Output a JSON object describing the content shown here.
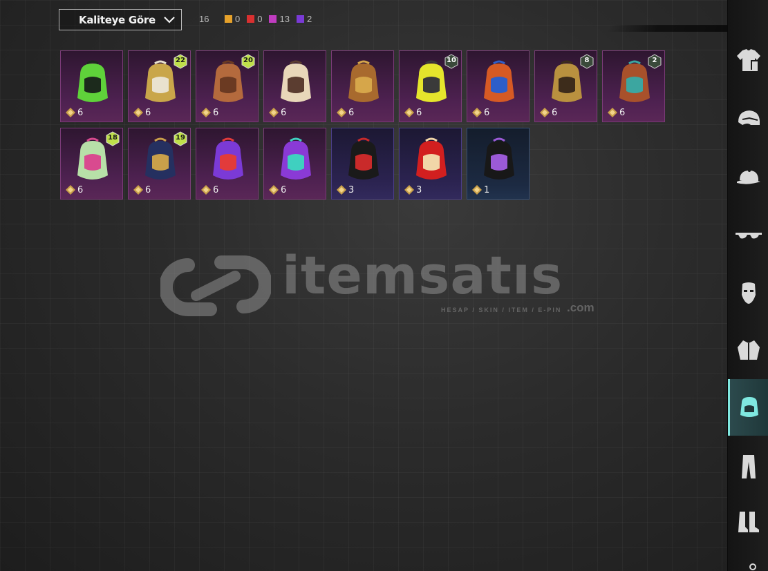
{
  "sort": {
    "label": "Kaliteye Göre"
  },
  "counts": {
    "total": "16",
    "legend": [
      {
        "color": "#e6a12a",
        "value": "0"
      },
      {
        "color": "#d93030",
        "value": "0"
      },
      {
        "color": "#c03cc0",
        "value": "13"
      },
      {
        "color": "#7a3ad6",
        "value": "2"
      }
    ]
  },
  "items": [
    {
      "qty": "6",
      "tier": "",
      "rarity": "purple",
      "icon": "neon-green-backpack"
    },
    {
      "qty": "6",
      "tier": "22",
      "rarity": "purple",
      "icon": "pharaoh-gold-backpack"
    },
    {
      "qty": "6",
      "tier": "20",
      "rarity": "purple",
      "icon": "bear-backpack"
    },
    {
      "qty": "6",
      "tier": "",
      "rarity": "purple",
      "icon": "skull-backpack"
    },
    {
      "qty": "6",
      "tier": "",
      "rarity": "purple",
      "icon": "treasure-chest-backpack"
    },
    {
      "qty": "6",
      "tier": "10",
      "rarity": "purple",
      "icon": "lightning-yellow-backpack"
    },
    {
      "qty": "6",
      "tier": "",
      "rarity": "purple",
      "icon": "orange-blue-backpack"
    },
    {
      "qty": "6",
      "tier": "8",
      "rarity": "purple",
      "icon": "steampunk-backpack"
    },
    {
      "qty": "6",
      "tier": "2",
      "rarity": "purple",
      "icon": "tribal-backpack"
    },
    {
      "qty": "6",
      "tier": "18",
      "rarity": "purple",
      "icon": "graffiti-backpack"
    },
    {
      "qty": "6",
      "tier": "19",
      "rarity": "purple",
      "icon": "armored-navy-backpack"
    },
    {
      "qty": "6",
      "tier": "",
      "rarity": "purple",
      "icon": "clown-backpack"
    },
    {
      "qty": "6",
      "tier": "",
      "rarity": "purple",
      "icon": "jester-backpack"
    },
    {
      "qty": "3",
      "tier": "",
      "rarity": "violet",
      "icon": "black-red-backpack"
    },
    {
      "qty": "3",
      "tier": "",
      "rarity": "violet",
      "icon": "red-club-backpack"
    },
    {
      "qty": "1",
      "tier": "",
      "rarity": "blue",
      "icon": "black-purple-backpack"
    }
  ],
  "watermark": {
    "word": "itemsatıs",
    "sub": "HESAP / SKIN / ITEM / E-PIN",
    "domain": ".com"
  },
  "sidebar": [
    {
      "name": "shirt-icon"
    },
    {
      "name": "helmet-icon"
    },
    {
      "name": "cap-icon"
    },
    {
      "name": "glasses-icon"
    },
    {
      "name": "mask-icon"
    },
    {
      "name": "jacket-icon"
    },
    {
      "name": "backpack-icon",
      "active": true
    },
    {
      "name": "pants-icon"
    },
    {
      "name": "boots-icon"
    }
  ]
}
